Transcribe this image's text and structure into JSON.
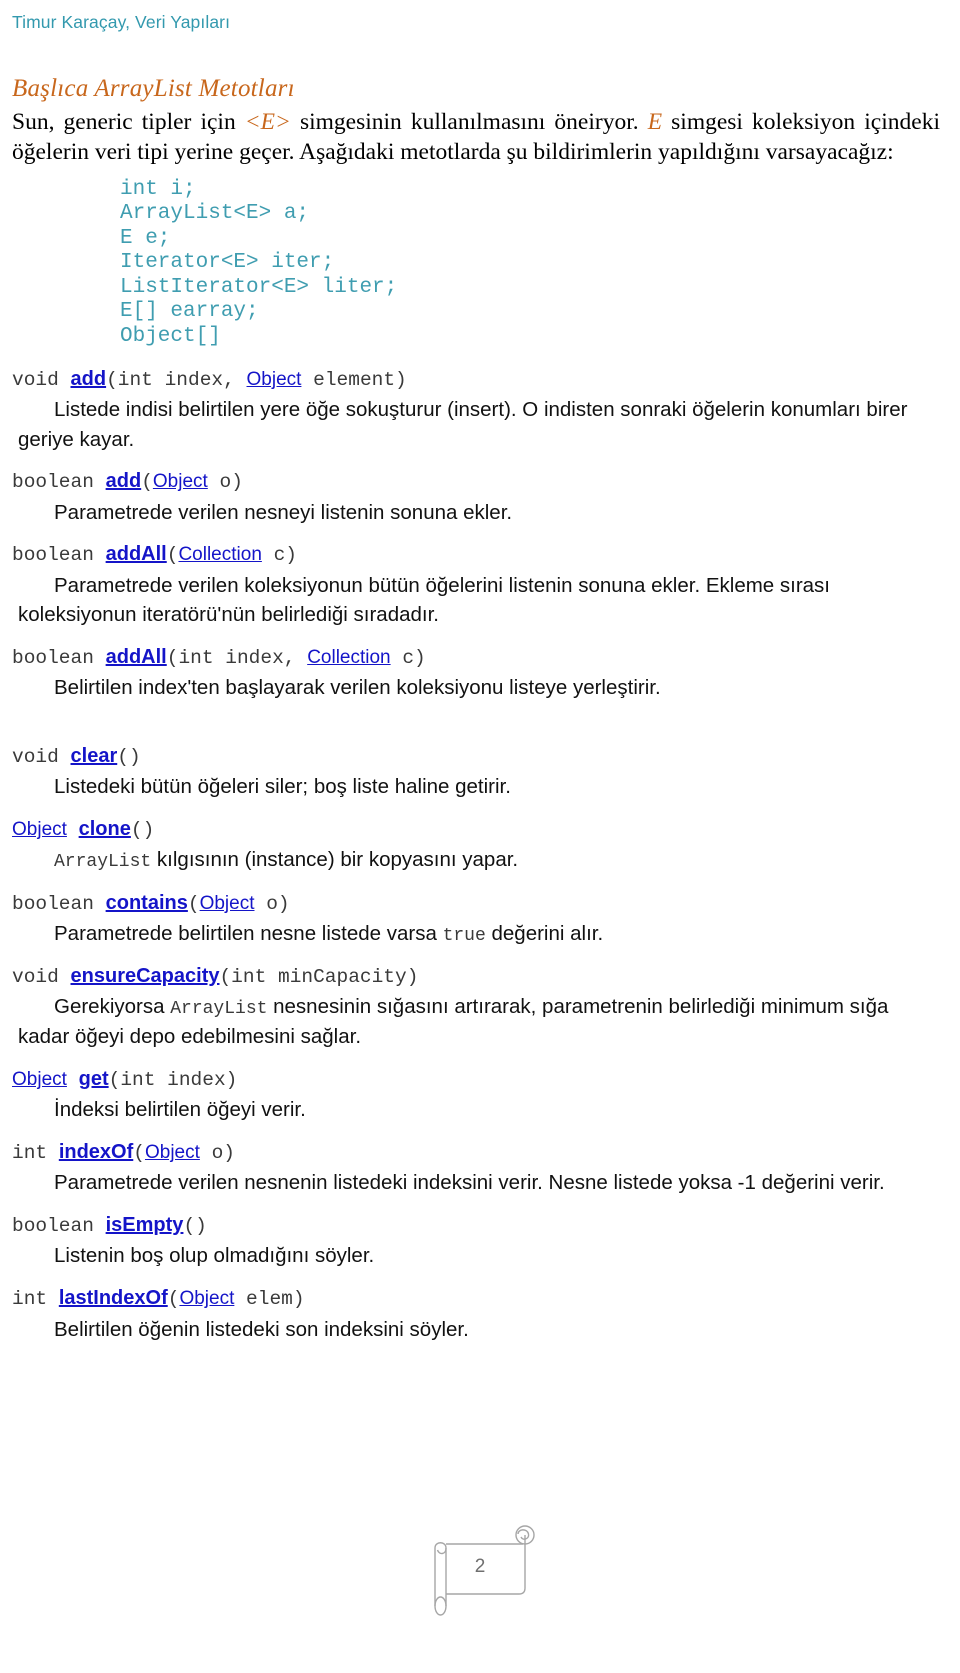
{
  "header": {
    "running_title": "Timur Karaçay, Veri Yapıları",
    "color": "#3399AE"
  },
  "section": {
    "title": "Başlıca ArrayList Metotları",
    "title_color": "#C8671C"
  },
  "intro": {
    "part1": "Sun, generic tipler için ",
    "generic1": "<E>",
    "part2": " simgesinin kullanılmasını öneiryor. ",
    "generic2": "E",
    "part3": " simgesi koleksiyon içindeki öğelerin veri tipi yerine geçer. Aşağıdaki metotlarda şu bildirimlerin yapıldığını varsayacağız:"
  },
  "declarations": {
    "color": "#3F9DB0",
    "lines": "int i;\nArrayList<E> a;\nE e;\nIterator<E> iter;\nListIterator<E> liter;\nE[] earray;\nObject[]"
  },
  "methods": [
    {
      "return": "void ",
      "name": "add",
      "params_pre": "(int index, ",
      "param_link": "Object",
      "params_post": " element)",
      "description": "Listede indisi belirtilen yere öğe sokuşturur (insert). O indisten sonraki öğelerin konumları birer geriye kayar."
    },
    {
      "return": "boolean ",
      "name": "add",
      "params_pre": "(",
      "param_link": "Object",
      "params_post": " o)",
      "description": "Parametrede verilen nesneyi listenin sonuna ekler."
    },
    {
      "return": "boolean ",
      "name": "addAll",
      "params_pre": "(",
      "param_link": "Collection",
      "params_post": " c)",
      "description": "Parametrede verilen koleksiyonun bütün öğelerini listenin sonuna ekler. Ekleme sırası koleksiyonun iteratörü'nün belirlediği sıradadır."
    },
    {
      "return": "boolean ",
      "name": "addAll",
      "params_pre": "(int index, ",
      "param_link": "Collection",
      "params_post": " c)",
      "description": "Belirtilen index'ten başlayarak verilen koleksiyonu listeye yerleştirir."
    },
    {
      "return": "void ",
      "name": "clear",
      "params_pre": "(",
      "param_link": "",
      "params_post": ")",
      "description": "Listedeki bütün öğeleri siler; boş liste haline getirir."
    },
    {
      "return_link": "Object",
      "return": " ",
      "name": "clone",
      "params_pre": "(",
      "param_link": "",
      "params_post": ")",
      "desc_mono": "ArrayList",
      "description": " kılgısının (instance) bir kopyasını yapar."
    },
    {
      "return": "boolean ",
      "name": "contains",
      "params_pre": "(",
      "param_link": "Object",
      "params_post": " o)",
      "desc_pre": "Parametrede belirtilen nesne listede varsa ",
      "desc_mono": "true",
      "desc_post": " değerini alır."
    },
    {
      "return": "void ",
      "name": "ensureCapacity",
      "params_pre": "(int minCapacity)",
      "param_link": "",
      "params_post": "",
      "desc_pre": "Gerekiyorsa ",
      "desc_mono": "ArrayList",
      "desc_post": " nesnesinin sığasını artırarak, parametrenin belirlediği minimum sığa kadar öğeyi depo edebilmesini sağlar."
    },
    {
      "return_link": "Object",
      "return": " ",
      "name": "get",
      "params_pre": "(int index)",
      "param_link": "",
      "params_post": "",
      "description": "İndeksi belirtilen öğeyi verir."
    },
    {
      "return": "int ",
      "name": "indexOf",
      "params_pre": "(",
      "param_link": "Object",
      "params_post": " o)",
      "description": "Parametrede verilen nesnenin listedeki indeksini verir. Nesne listede yoksa -1 değerini verir."
    },
    {
      "return": "boolean ",
      "name": "isEmpty",
      "params_pre": "(",
      "param_link": "",
      "params_post": ")",
      "description": "Listenin boş olup olmadığını söyler."
    },
    {
      "return": "int ",
      "name": "lastIndexOf",
      "params_pre": "(",
      "param_link": "Object",
      "params_post": " elem)",
      "description": "Belirtilen öğenin listedeki son indeksini söyler."
    }
  ],
  "footer": {
    "page_number": "2"
  }
}
